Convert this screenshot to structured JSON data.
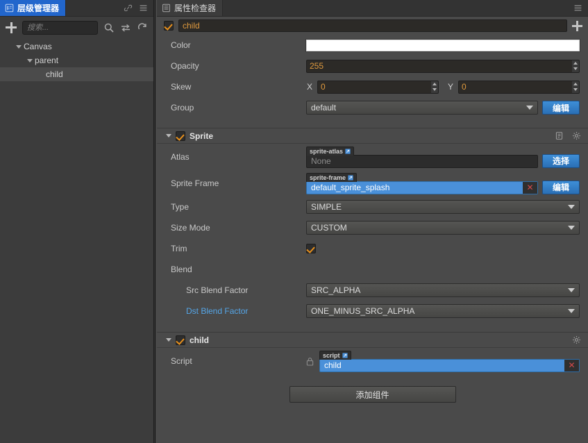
{
  "hierarchy": {
    "tab_label": "层级管理器",
    "tab_icon": "hierarchy-icon",
    "toolbar": {
      "add_label": "+",
      "search_placeholder": "搜索...",
      "search_value": "",
      "icons": [
        "search-icon",
        "sync-arrows-icon",
        "refresh-icon"
      ]
    },
    "panel_icons": [
      "link-icon",
      "menu-icon"
    ],
    "tree": [
      {
        "label": "Canvas",
        "depth": 0,
        "expanded": true,
        "selected": false
      },
      {
        "label": "parent",
        "depth": 1,
        "expanded": true,
        "selected": false
      },
      {
        "label": "child",
        "depth": 2,
        "expanded": false,
        "selected": true
      }
    ]
  },
  "inspector": {
    "tab_label": "属性检查器",
    "tab_icon": "inspector-icon",
    "panel_menu_icon": "menu-icon",
    "node": {
      "enabled": true,
      "name": "child",
      "add_label": "+"
    },
    "node_props": [
      {
        "label": "Color",
        "type": "color",
        "value": "#ffffff"
      },
      {
        "label": "Opacity",
        "type": "number",
        "value": "255"
      },
      {
        "label": "Skew",
        "type": "xy",
        "x_label": "X",
        "x_value": "0",
        "y_label": "Y",
        "y_value": "0"
      },
      {
        "label": "Group",
        "type": "select_button",
        "value": "default",
        "button": "编辑"
      }
    ],
    "sprite_section": {
      "title": "Sprite",
      "enabled": true,
      "expanded": true,
      "icons": [
        "help-doc-icon",
        "gear-icon"
      ],
      "atlas": {
        "label": "Atlas",
        "tag": "sprite-atlas",
        "value": "None",
        "empty": true,
        "button": "选择"
      },
      "sprite_frame": {
        "label": "Sprite Frame",
        "tag": "sprite-frame",
        "value": "default_sprite_splash",
        "empty": false,
        "clear": "✕",
        "button": "编辑"
      },
      "type": {
        "label": "Type",
        "value": "SIMPLE"
      },
      "size_mode": {
        "label": "Size Mode",
        "value": "CUSTOM"
      },
      "trim": {
        "label": "Trim",
        "checked": true
      },
      "blend": {
        "label": "Blend"
      },
      "src_blend": {
        "label": "Src Blend Factor",
        "value": "SRC_ALPHA"
      },
      "dst_blend": {
        "label": "Dst Blend Factor",
        "value": "ONE_MINUS_SRC_ALPHA",
        "highlighted": true
      }
    },
    "script_section": {
      "title": "child",
      "enabled": true,
      "expanded": true,
      "icons": [
        "gear-icon"
      ],
      "script": {
        "label": "Script",
        "tag": "script",
        "value": "child",
        "locked": true,
        "clear": "✕"
      }
    },
    "add_component_label": "添加组件"
  },
  "colors": {
    "accent_blue": "#2266cc",
    "field_orange": "#e09a3e",
    "asset_blue": "#4a90d9",
    "link_blue": "#55a6e8",
    "check_orange": "#e8901c",
    "clear_red": "#d24a4a",
    "panel_bg": "#4a4a4a",
    "left_bg": "#3c3c3c"
  }
}
